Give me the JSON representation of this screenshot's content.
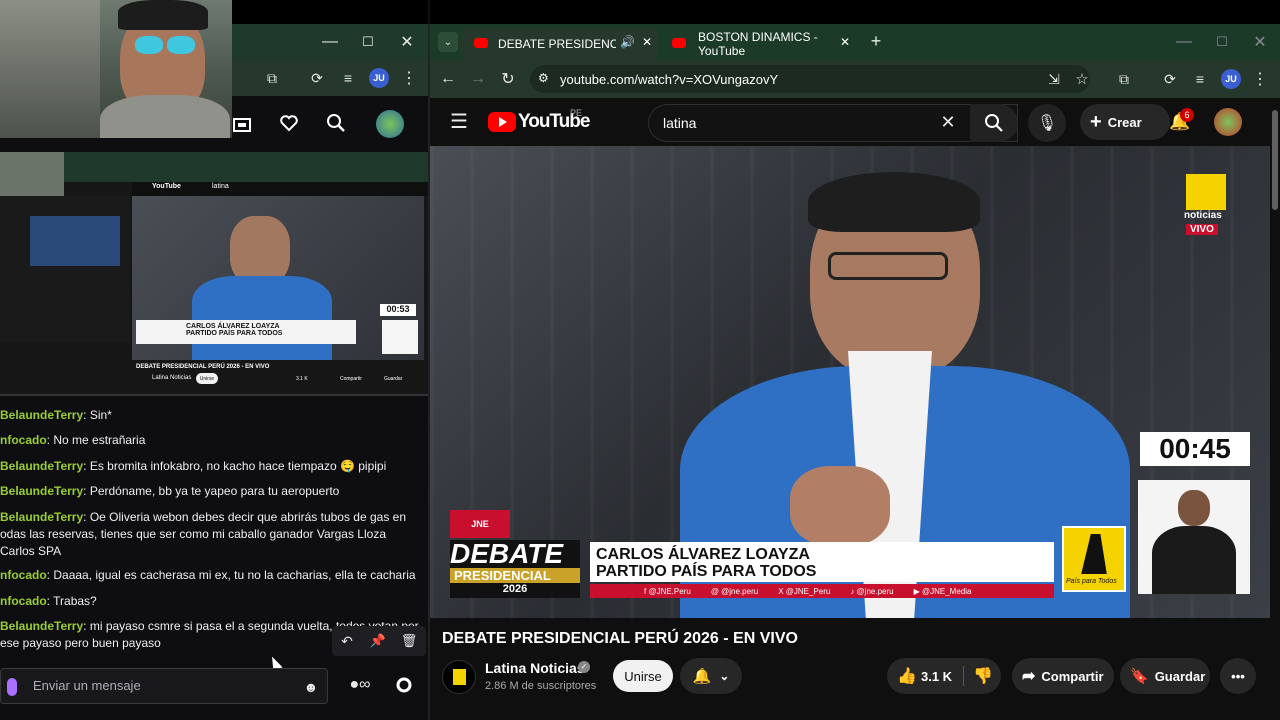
{
  "left_browser": {
    "window_controls": [
      "—",
      "☐",
      "✕"
    ],
    "profile_initials": "JU"
  },
  "stream_preview": {
    "video_title": "DEBATE PRESIDENCIAL PERÚ 2026 - EN VIVO",
    "channel": "Latina Noticias",
    "timer": "00:53",
    "lower_third_name": "CARLOS ÁLVAREZ LOAYZA",
    "lower_third_party": "PARTIDO PAÍS PARA TODOS",
    "join_label": "Unirse",
    "likes": "3.1 K",
    "share_label": "Compartir",
    "save_label": "Guardar"
  },
  "chat": {
    "messages": [
      {
        "user": "BelaundeTerry",
        "text": " Sin*"
      },
      {
        "user": "nfocado",
        "text": " No me estrañaria"
      },
      {
        "user": "BelaundeTerry",
        "text": " Es bromita infokabro, no kacho hace tiempazo 🤤 pipipi"
      },
      {
        "user": "BelaundeTerry",
        "text": " Perdóname, bb ya te yapeo para tu aeropuerto"
      },
      {
        "user": "BelaundeTerry",
        "text": " Oe Oliveria webon debes decir que abrirás tubos de gas en",
        "line2": "odas las reservas, tienes que ser como mi caballo ganador Vargas Lloza",
        "line3": "Carlos SPA"
      },
      {
        "user": "nfocado",
        "text": " Daaaa, igual es cacherasa mi ex, tu no la cacharias, ella te cacharia"
      },
      {
        "user": "nfocado",
        "text": " Trabas?"
      },
      {
        "user": "BelaundeTerry",
        "text": " mi payaso csmre si pasa el a segunda vuelta, todos votan por",
        "line2": "ese payaso pero buen payaso"
      }
    ],
    "input_placeholder": "Enviar un mensaje"
  },
  "right_browser": {
    "tabs": [
      {
        "label": "DEBATE PRESIDENCIAL PERÚ",
        "active": true
      },
      {
        "label": "BOSTON DINAMICS - YouTube",
        "active": false
      }
    ],
    "url": "youtube.com/watch?v=XOVungazovY",
    "profile_initials": "JU"
  },
  "youtube": {
    "logo_text": "YouTube",
    "region": "PE",
    "search_value": "latina",
    "create_label": "Crear",
    "notif_count": "6",
    "video": {
      "channel_bug_line1": "noticias",
      "channel_bug_line2": "VIVO",
      "timer": "00:45",
      "debate_line1": "DEBATE",
      "debate_line2": "PRESIDENCIAL",
      "debate_year": "2026",
      "candidate_name": "CARLOS ÁLVAREZ LOAYZA",
      "candidate_party": "PARTIDO PAÍS PARA TODOS",
      "socials": [
        "f @JNE.Peru",
        "@ @jne.peru",
        "X @JNE_Peru",
        "♪ @jne.peru",
        "▶ @JNE_Media"
      ],
      "party_logo_text": "País para Todos",
      "jne_label": "JNE"
    },
    "title": "DEBATE PRESIDENCIAL PERÚ 2026 - EN VIVO",
    "channel_name": "Latina Noticias",
    "subscribers": "2.86 M de suscriptores",
    "join_label": "Unirse",
    "likes": "3.1 K",
    "share_label": "Compartir",
    "save_label": "Guardar"
  },
  "colors": {
    "username": "#9acd32",
    "yt_red": "#ff0000",
    "tab_bar": "#1b3a28",
    "toolbar": "#26382c",
    "lower_third_red": "#c8102e",
    "party_yellow": "#f5d300"
  }
}
